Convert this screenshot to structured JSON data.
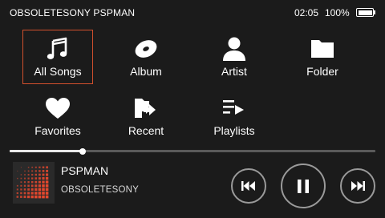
{
  "status": {
    "device_name": "OBSOLETESONY PSPMAN",
    "time": "02:05",
    "battery_percent": "100%",
    "battery_level": 1.0
  },
  "menu": {
    "items": [
      {
        "label": "All Songs",
        "icon": "music-note-icon",
        "selected": true
      },
      {
        "label": "Album",
        "icon": "disc-icon",
        "selected": false
      },
      {
        "label": "Artist",
        "icon": "person-icon",
        "selected": false
      },
      {
        "label": "Folder",
        "icon": "folder-icon",
        "selected": false
      },
      {
        "label": "Favorites",
        "icon": "heart-icon",
        "selected": false
      },
      {
        "label": "Recent",
        "icon": "recent-files-icon",
        "selected": false
      },
      {
        "label": "Playlists",
        "icon": "playlist-icon",
        "selected": false
      }
    ]
  },
  "player": {
    "title": "PSPMAN",
    "artist": "OBSOLETESONY",
    "progress": 0.2,
    "state": "playing",
    "controls": [
      "previous-track-icon",
      "pause-icon",
      "next-track-icon"
    ]
  },
  "colors": {
    "background": "#1b1b1b",
    "selection_border": "#d2502d",
    "album_art_accent": "#e5482e",
    "progress_track": "#5a5a5a",
    "progress_fill": "#e8e8e8",
    "control_ring": "#9a9a9a"
  }
}
